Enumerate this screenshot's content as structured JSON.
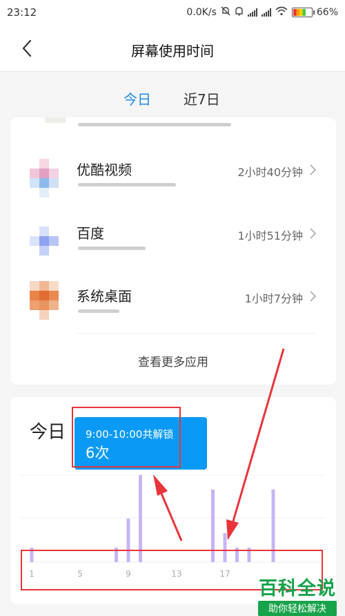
{
  "status": {
    "time": "23:12",
    "net_speed": "0.0K/s",
    "battery": "66%"
  },
  "header": {
    "title": "屏幕使用时间"
  },
  "tabs": [
    {
      "label": "今日",
      "active": true
    },
    {
      "label": "近7日",
      "active": false
    }
  ],
  "apps": [
    {
      "name": "优酷视频",
      "time": "2小时40分钟"
    },
    {
      "name": "百度",
      "time": "1小时51分钟"
    },
    {
      "name": "系统桌面",
      "time": "1小时7分钟"
    }
  ],
  "more_label": "查看更多应用",
  "unlock_section": {
    "title": "今日"
  },
  "tooltip": {
    "range": "9:00-10:00共解锁",
    "count": "6次"
  },
  "chart_data": {
    "type": "bar",
    "x_ticks": [
      "1",
      "5",
      "9",
      "13",
      "17"
    ],
    "hours": [
      1,
      8,
      9,
      10,
      16,
      17,
      18,
      19,
      21
    ],
    "values": [
      1,
      1,
      3,
      6,
      5,
      2,
      1,
      1,
      5
    ],
    "bar_color": "#c8b4f5"
  },
  "watermark": {
    "title": "百科全说",
    "subtitle": "助你轻松解决"
  },
  "colors": {
    "accent": "#1e88e5",
    "tooltip": "#0a9af5",
    "annotation": "#e8343a",
    "watermark": "#16a34a"
  }
}
